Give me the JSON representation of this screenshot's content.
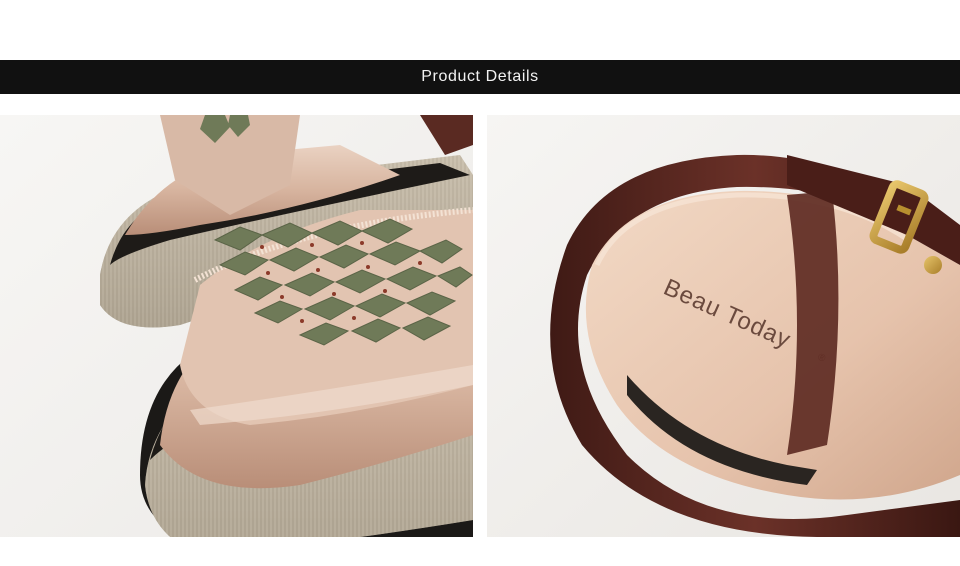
{
  "header": {
    "title": "Product Details"
  },
  "photos": [
    {
      "name": "sandal-toe-closeup"
    },
    {
      "name": "sandal-insole-closeup",
      "insole_brand": "Beau Today"
    }
  ],
  "colors": {
    "header_bg": "#111111",
    "header_text": "#f2f2f2",
    "satin": "#d9b9a4",
    "stones": "#6f7a58",
    "leather": "#5a2a22",
    "buckle": "#c9a046",
    "platform": "#bdb3a2"
  }
}
